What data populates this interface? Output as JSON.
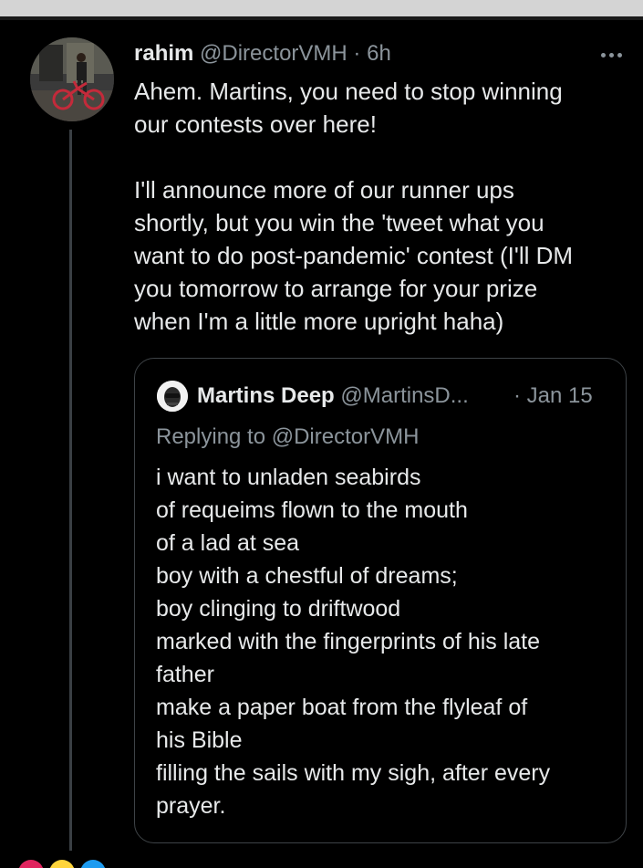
{
  "tweet": {
    "author_name": "rahim",
    "handle": "@DirectorVMH",
    "separator": "·",
    "time": "6h",
    "body_lines": [
      "Ahem. Martins, you need to stop winning",
      "our contests over here!"
    ],
    "body_lines_2": [
      "I'll announce more of our runner ups",
      "shortly, but you win the 'tweet what you",
      "want to do post-pandemic' contest (I'll DM",
      "you tomorrow to arrange for your prize",
      "when I'm a little more upright haha)"
    ]
  },
  "quoted": {
    "author_name": "Martins Deep",
    "handle": "@MartinsD...",
    "date": "· Jan 15",
    "replying_to": "Replying to @DirectorVMH",
    "lines": [
      "i want to unladen seabirds",
      "of requeims flown to the mouth",
      "of a lad at sea",
      "boy with a chestful of dreams;",
      "boy clinging to driftwood",
      "marked with the fingerprints of his late",
      "father",
      "make a paper boat from the flyleaf of",
      "his Bible",
      "filling the sails with my sigh, after every",
      "prayer."
    ]
  },
  "reaction_colors": [
    "#e0245e",
    "#ffd43b",
    "#1d9bf0"
  ],
  "colors": {
    "background": "#000000",
    "text": "#e7e9ea",
    "secondary": "#8b949b",
    "border": "#3e4347"
  }
}
